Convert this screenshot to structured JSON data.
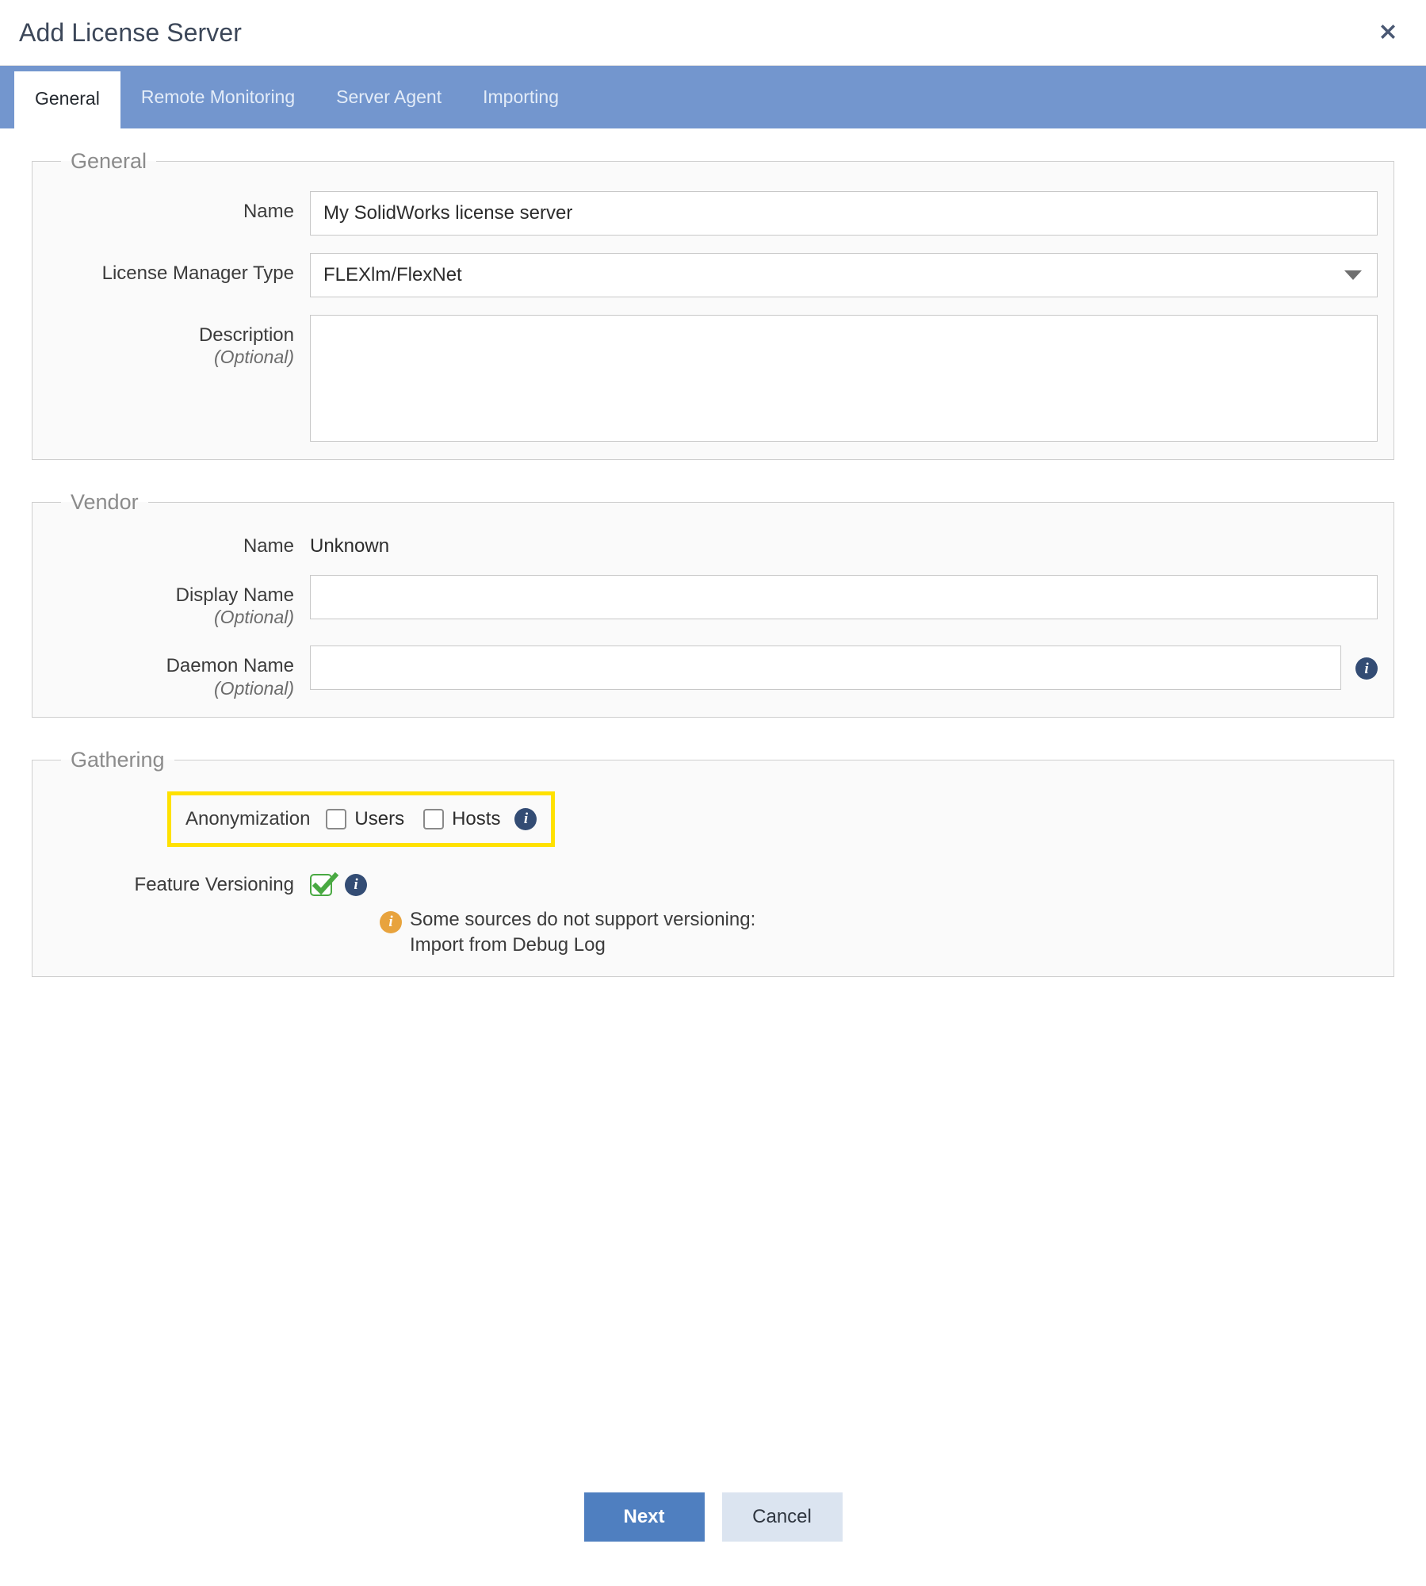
{
  "dialog": {
    "title": "Add License Server",
    "close_icon": "close-icon"
  },
  "tabs": [
    {
      "label": "General",
      "active": true
    },
    {
      "label": "Remote Monitoring",
      "active": false
    },
    {
      "label": "Server Agent",
      "active": false
    },
    {
      "label": "Importing",
      "active": false
    }
  ],
  "general": {
    "legend": "General",
    "name": {
      "label": "Name",
      "value": "My SolidWorks license server",
      "placeholder": ""
    },
    "license_manager_type": {
      "label": "License Manager Type",
      "value": "FLEXlm/FlexNet",
      "caret_icon": "chevron-down-icon"
    },
    "description": {
      "label": "Description",
      "optional": "(Optional)",
      "value": "",
      "placeholder": ""
    }
  },
  "vendor": {
    "legend": "Vendor",
    "name": {
      "label": "Name",
      "value": "Unknown"
    },
    "display_name": {
      "label": "Display Name",
      "optional": "(Optional)",
      "value": "",
      "placeholder": ""
    },
    "daemon_name": {
      "label": "Daemon Name",
      "optional": "(Optional)",
      "value": "",
      "placeholder": "",
      "info_icon": "info-icon"
    }
  },
  "gathering": {
    "legend": "Gathering",
    "anonymization": {
      "label": "Anonymization",
      "users_label": "Users",
      "users_checked": false,
      "hosts_label": "Hosts",
      "hosts_checked": false,
      "info_icon": "info-icon",
      "highlight_color": "#ffe100"
    },
    "feature_versioning": {
      "label": "Feature Versioning",
      "checked": true,
      "check_color": "#49a942",
      "info_icon": "info-icon",
      "note_icon": "warning-info-icon",
      "note_line1": "Some sources do not support versioning:",
      "note_line2": "Import from Debug Log"
    }
  },
  "footer": {
    "next_label": "Next",
    "cancel_label": "Cancel",
    "primary_color": "#4f7fc0",
    "secondary_color": "#dbe4f0"
  }
}
